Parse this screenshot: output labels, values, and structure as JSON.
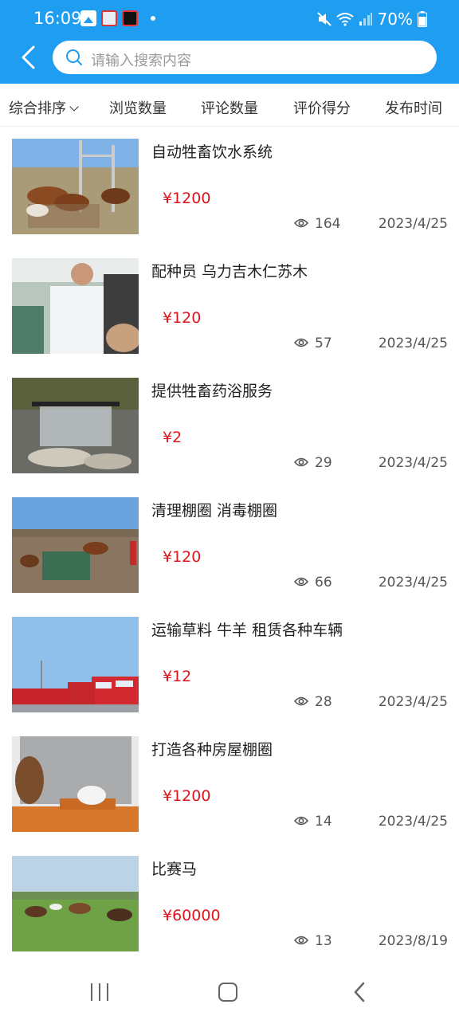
{
  "status_bar": {
    "time": "16:09",
    "battery_percent": "70%",
    "icons_left": [
      "gallery-icon",
      "app-notification-icon",
      "screen-record-icon"
    ],
    "icons_right": [
      "mute-icon",
      "wifi-icon",
      "signal-icon",
      "battery-icon"
    ]
  },
  "header": {
    "back_icon": "chevron-left-icon",
    "search": {
      "placeholder": "请输入搜索内容",
      "value": ""
    }
  },
  "sort_bar": {
    "items": [
      {
        "label": "综合排序",
        "has_dropdown": true
      },
      {
        "label": "浏览数量"
      },
      {
        "label": "评论数量"
      },
      {
        "label": "评价得分"
      },
      {
        "label": "发布时间"
      }
    ]
  },
  "listings": [
    {
      "title": "自动牲畜饮水系统",
      "price": "¥1200",
      "views": "164",
      "date": "2023/4/25"
    },
    {
      "title": "配种员 乌力吉木仁苏木",
      "price": "¥120",
      "views": "57",
      "date": "2023/4/25"
    },
    {
      "title": "提供牲畜药浴服务",
      "price": "¥2",
      "views": "29",
      "date": "2023/4/25"
    },
    {
      "title": "清理棚圈 消毒棚圈",
      "price": "¥120",
      "views": "66",
      "date": "2023/4/25"
    },
    {
      "title": "运输草料 牛羊 租赁各种车辆",
      "price": "¥12",
      "views": "28",
      "date": "2023/4/25"
    },
    {
      "title": "打造各种房屋棚圈",
      "price": "¥1200",
      "views": "14",
      "date": "2023/4/25"
    },
    {
      "title": "比赛马",
      "price": "¥60000",
      "views": "13",
      "date": "2023/8/19"
    }
  ],
  "colors": {
    "header_blue": "#1e9df1",
    "price_red": "#e1141d"
  },
  "nav_bar": {
    "icons": [
      "recent-apps-icon",
      "home-icon",
      "back-icon"
    ]
  }
}
